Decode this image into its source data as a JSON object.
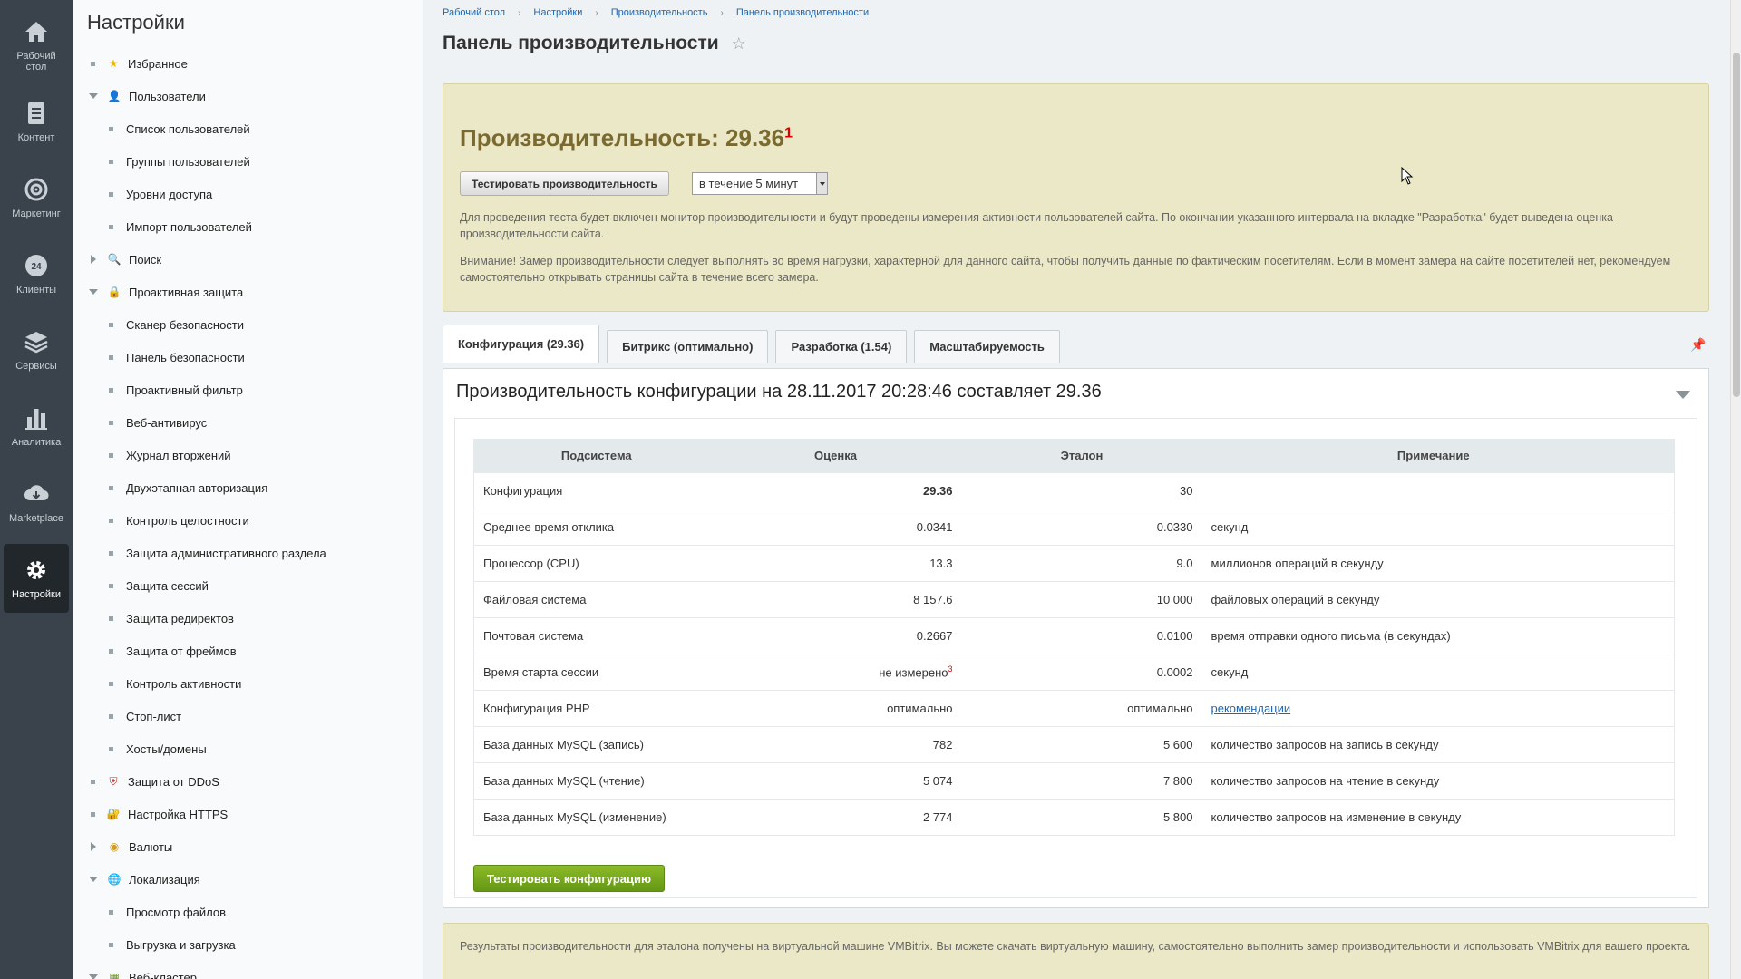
{
  "rail": [
    {
      "label": "Рабочий\nстол",
      "icon": "home-icon"
    },
    {
      "label": "Контент",
      "icon": "document-icon"
    },
    {
      "label": "Маркетинг",
      "icon": "target-icon"
    },
    {
      "label": "Клиенты",
      "icon": "clients-24-icon"
    },
    {
      "label": "Сервисы",
      "icon": "layers-icon"
    },
    {
      "label": "Аналитика",
      "icon": "bar-chart-icon"
    },
    {
      "label": "Marketplace",
      "icon": "cloud-download-icon"
    },
    {
      "label": "Настройки",
      "icon": "gear-icon"
    }
  ],
  "sidebar": {
    "title": "Настройки",
    "items": [
      {
        "label": "Избранное",
        "type": "bullet",
        "icon": "star-icon"
      },
      {
        "label": "Пользователи",
        "type": "expanded",
        "icon": "user-icon"
      },
      {
        "label": "Список пользователей",
        "type": "sub"
      },
      {
        "label": "Группы пользователей",
        "type": "sub"
      },
      {
        "label": "Уровни доступа",
        "type": "sub"
      },
      {
        "label": "Импорт пользователей",
        "type": "sub"
      },
      {
        "label": "Поиск",
        "type": "collapsed",
        "icon": "search-icon"
      },
      {
        "label": "Проактивная защита",
        "type": "expanded",
        "icon": "lock-icon"
      },
      {
        "label": "Сканер безопасности",
        "type": "sub"
      },
      {
        "label": "Панель безопасности",
        "type": "sub"
      },
      {
        "label": "Проактивный фильтр",
        "type": "sub"
      },
      {
        "label": "Веб-антивирус",
        "type": "sub"
      },
      {
        "label": "Журнал вторжений",
        "type": "sub"
      },
      {
        "label": "Двухэтапная авторизация",
        "type": "sub"
      },
      {
        "label": "Контроль целостности",
        "type": "sub"
      },
      {
        "label": "Защита административного раздела",
        "type": "sub"
      },
      {
        "label": "Защита сессий",
        "type": "sub"
      },
      {
        "label": "Защита редиректов",
        "type": "sub"
      },
      {
        "label": "Защита от фреймов",
        "type": "sub"
      },
      {
        "label": "Контроль активности",
        "type": "sub"
      },
      {
        "label": "Стоп-лист",
        "type": "sub"
      },
      {
        "label": "Хосты/домены",
        "type": "sub"
      },
      {
        "label": "Защита от DDoS",
        "type": "bullet",
        "icon": "shield-icon"
      },
      {
        "label": "Настройка HTTPS",
        "type": "bullet",
        "icon": "https-lock-icon"
      },
      {
        "label": "Валюты",
        "type": "collapsed",
        "icon": "currency-icon"
      },
      {
        "label": "Локализация",
        "type": "expanded",
        "icon": "globe-icon"
      },
      {
        "label": "Просмотр файлов",
        "type": "sub"
      },
      {
        "label": "Выгрузка и загрузка",
        "type": "sub"
      },
      {
        "label": "Веб-кластер",
        "type": "expanded",
        "icon": "cluster-icon"
      }
    ]
  },
  "breadcrumbs": [
    "Рабочий стол",
    "Настройки",
    "Производительность",
    "Панель производительности"
  ],
  "page_title": "Панель производительности",
  "perf": {
    "title": "Производительность: 29.36",
    "footnote": "1",
    "test_button": "Тестировать производительность",
    "duration": "в течение 5 минут",
    "info1": "Для проведения теста будет включен монитор производительности и будут проведены измерения активности пользователей сайта. По окончании указанного интервала на вкладке \"Разработка\" будет выведена оценка производительности сайта.",
    "info2": "Внимание! Замер производительности следует выполнять во время нагрузки, характерной для данного сайта, чтобы получить данные по фактическим посетителям. Если в момент замера на сайте посетителей нет, рекомендуем самостоятельно открывать страницы сайта в течение всего замера."
  },
  "tabs": [
    "Конфигурация (29.36)",
    "Битрикс (оптимально)",
    "Разработка (1.54)",
    "Масштабируемость"
  ],
  "panel": {
    "heading": "Производительность конфигурации на 28.11.2017 20:28:46 составляет 29.36",
    "columns": [
      "Подсистема",
      "Оценка",
      "Эталон",
      "Примечание"
    ],
    "rows": [
      {
        "name": "Конфигурация",
        "score": "29.36",
        "ref": "30",
        "note": "",
        "bold": true
      },
      {
        "name": "Среднее время отклика",
        "score": "0.0341",
        "ref": "0.0330",
        "note": "секунд"
      },
      {
        "name": "Процессор (CPU)",
        "score": "13.3",
        "ref": "9.0",
        "note": "миллионов операций в секунду"
      },
      {
        "name": "Файловая система",
        "score": "8 157.6",
        "ref": "10 000",
        "note": "файловых операций в секунду"
      },
      {
        "name": "Почтовая система",
        "score": "0.2667",
        "ref": "0.0100",
        "note": "время отправки одного письма (в секундах)"
      },
      {
        "name": "Время старта сессии",
        "score": "не измерено",
        "score_sup": "3",
        "ref": "0.0002",
        "note": "секунд"
      },
      {
        "name": "Конфигурация PHP",
        "score": "оптимально",
        "ref": "оптимально",
        "note": "рекомендации",
        "link": true
      },
      {
        "name": "База данных MySQL (запись)",
        "score": "782",
        "ref": "5 600",
        "note": "количество запросов на запись в секунду"
      },
      {
        "name": "База данных MySQL (чтение)",
        "score": "5 074",
        "ref": "7 800",
        "note": "количество запросов на чтение в секунду"
      },
      {
        "name": "База данных MySQL (изменение)",
        "score": "2 774",
        "ref": "5 800",
        "note": "количество запросов на изменение в секунду"
      }
    ],
    "test_button": "Тестировать конфигурацию"
  },
  "footer_note": "Результаты производительности для эталона получены на виртуальной машине VMBitrix. Вы можете скачать виртуальную машину, самостоятельно выполнить замер производительности и использовать VMBitrix для вашего проекта.",
  "colors": {
    "rail_bg": "#3a424b",
    "accent_box": "#ebe8c7",
    "green_button": "#74a81c",
    "link": "#2067b0"
  }
}
